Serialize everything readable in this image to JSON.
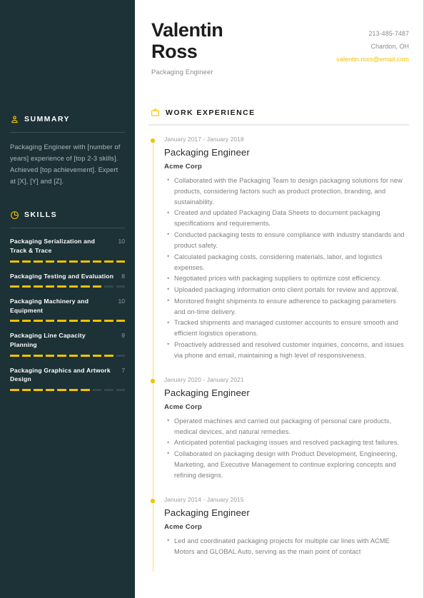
{
  "colors": {
    "sidebar_bg": "#1d3237",
    "accent": "#f2c200",
    "accent_light": "#f6dd7a",
    "body_text": "#7e7e7e",
    "heading_text": "#1c1c1c",
    "rule": "#e5eaef"
  },
  "header": {
    "name": "Valentin Ross",
    "name_line1": "Valentin",
    "name_line2": "Ross",
    "job_title": "Packaging Engineer",
    "phone": "213-485-7487",
    "location": "Chardon, OH",
    "email": "valentin.ross@email.com"
  },
  "sidebar": {
    "summary": {
      "icon": "person-icon",
      "label": "SUMMARY",
      "text": "Packaging Engineer with [number of years] experience of [top 2-3 skills]. Achieved [top achievement]. Expert at [X], [Y] and [Z]."
    },
    "skills": {
      "icon": "pie-chart-icon",
      "label": "SKILLS",
      "max": 10,
      "items": [
        {
          "name": "Packaging Serialization and Track & Trace",
          "score": 10
        },
        {
          "name": "Packaging Testing and Evaluation",
          "score": 8
        },
        {
          "name": "Packaging Machinery and Equipment",
          "score": 10
        },
        {
          "name": "Packaging Line Capacity Planning",
          "score": 9
        },
        {
          "name": "Packaging Graphics and Artwork Design",
          "score": 7
        }
      ]
    }
  },
  "main": {
    "work_experience": {
      "icon": "briefcase-icon",
      "label": "WORK EXPERIENCE",
      "entries": [
        {
          "dates": "January 2017 - January 2018",
          "role": "Packaging Engineer",
          "company": "Acme Corp",
          "bullets": [
            "Collaborated with the Packaging Team to design packaging solutions for new products, considering factors such as product protection, branding, and sustainability.",
            "Created and updated Packaging Data Sheets to document packaging specifications and requirements.",
            "Conducted packaging tests to ensure compliance with industry standards and product safety.",
            "Calculated packaging costs, considering materials, labor, and logistics expenses.",
            "Negotiated prices with packaging suppliers to optimize cost efficiency.",
            "Uploaded packaging information onto client portals for review and approval.",
            "Monitored freight shipments to ensure adherence to packaging parameters and on-time delivery.",
            "Tracked shipments and managed customer accounts to ensure smooth and efficient logistics operations.",
            "Proactively addressed and resolved customer inquiries, concerns, and issues via phone and email, maintaining a high level of responsiveness."
          ]
        },
        {
          "dates": "January 2020 - January 2021",
          "role": "Packaging Engineer",
          "company": "Acme Corp",
          "bullets": [
            "Operated machines and carried out packaging of personal care products, medical devices, and natural remedies.",
            "Anticipated potential packaging issues and resolved packaging test failures.",
            "Collaborated on packaging design with Product Development, Engineering, Marketing, and Executive Management to continue exploring concepts and refining designs."
          ]
        },
        {
          "dates": "January 2014 - January 2015",
          "role": "Packaging Engineer",
          "company": "Acme Corp",
          "bullets": [
            "Led and coordinated packaging projects for multiple car lines with ACME Motors and GLOBAL Auto, serving as the main point of contact"
          ]
        }
      ]
    }
  }
}
